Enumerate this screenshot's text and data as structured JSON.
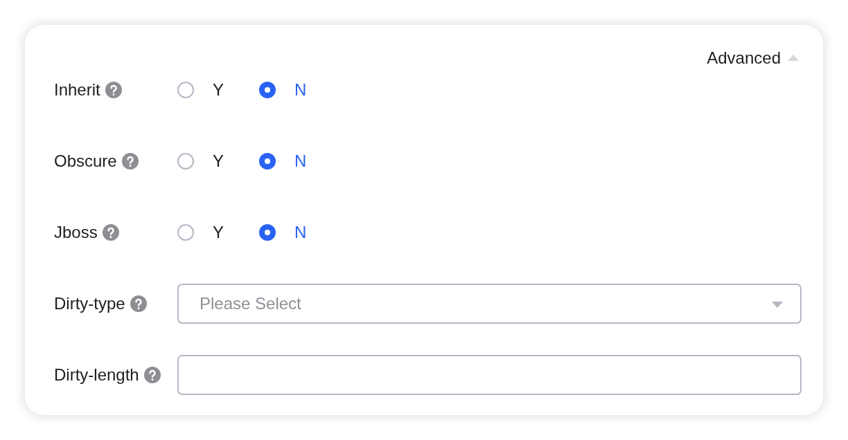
{
  "advanced_toggle": {
    "label": "Advanced",
    "expanded": true
  },
  "fields": [
    {
      "kind": "radio",
      "label": "Inherit",
      "options": [
        {
          "label": "Y",
          "selected": false
        },
        {
          "label": "N",
          "selected": true
        }
      ]
    },
    {
      "kind": "radio",
      "label": "Obscure",
      "options": [
        {
          "label": "Y",
          "selected": false
        },
        {
          "label": "N",
          "selected": true
        }
      ]
    },
    {
      "kind": "radio",
      "label": "Jboss",
      "options": [
        {
          "label": "Y",
          "selected": false
        },
        {
          "label": "N",
          "selected": true
        }
      ]
    },
    {
      "kind": "select",
      "label": "Dirty-type",
      "placeholder": "Please Select"
    },
    {
      "kind": "text",
      "label": "Dirty-length"
    }
  ]
}
